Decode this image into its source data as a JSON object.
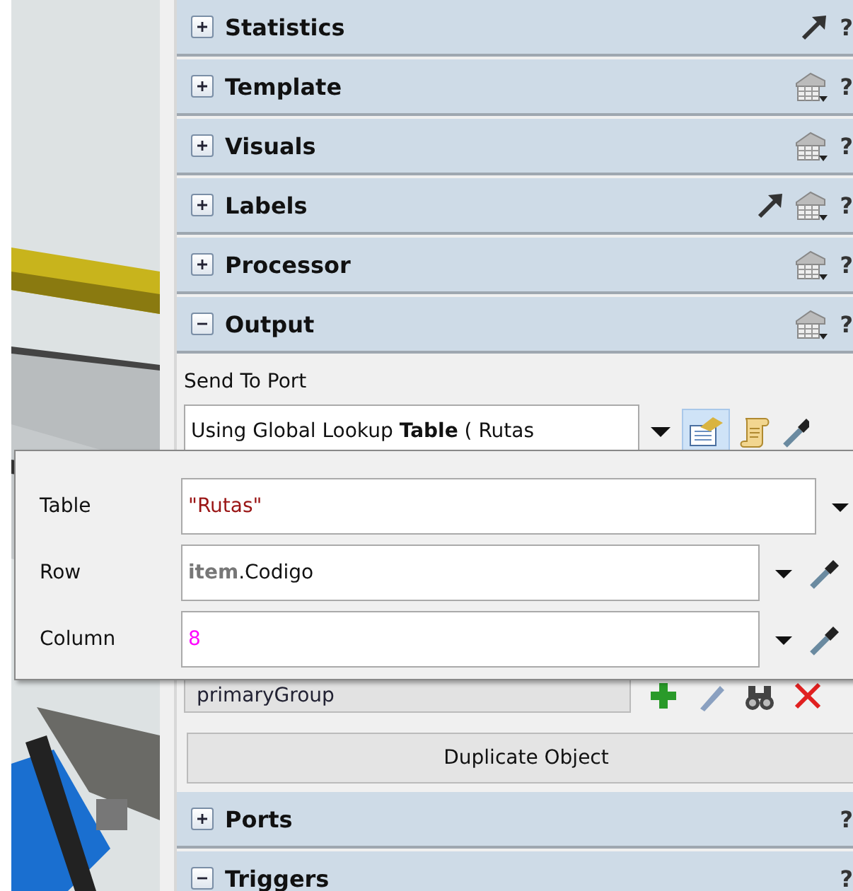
{
  "sections_top": [
    {
      "title": "Statistics",
      "expanded": false,
      "link_arrow": true,
      "help": "?"
    },
    {
      "title": "Template",
      "expanded": false,
      "table_menu": true,
      "help": "?"
    },
    {
      "title": "Visuals",
      "expanded": false,
      "table_menu": true,
      "help": "?"
    },
    {
      "title": "Labels",
      "expanded": false,
      "link_arrow": true,
      "table_menu": true,
      "help": "?"
    },
    {
      "title": "Processor",
      "expanded": false,
      "table_menu": true,
      "help": "?"
    },
    {
      "title": "Output",
      "expanded": true,
      "table_menu": true,
      "help": "?"
    }
  ],
  "output": {
    "send_label": "Send To Port",
    "send_value": "Using Global Lookup **Table** ( Rutas",
    "group_value": "primaryGroup",
    "duplicate_button": "Duplicate Object"
  },
  "popup": {
    "fields": [
      {
        "label": "Table",
        "value": "\"Rutas\"",
        "kind": "string",
        "eyedropper": false
      },
      {
        "label": "Row",
        "value": "**item**.Codigo",
        "kind": "code",
        "eyedropper": true
      },
      {
        "label": "Column",
        "value": "8",
        "kind": "number",
        "eyedropper": true
      }
    ]
  },
  "sections_bottom": [
    {
      "title": "Ports",
      "expanded": false,
      "help": "?"
    },
    {
      "title": "Triggers",
      "expanded": true,
      "help": "?"
    }
  ]
}
